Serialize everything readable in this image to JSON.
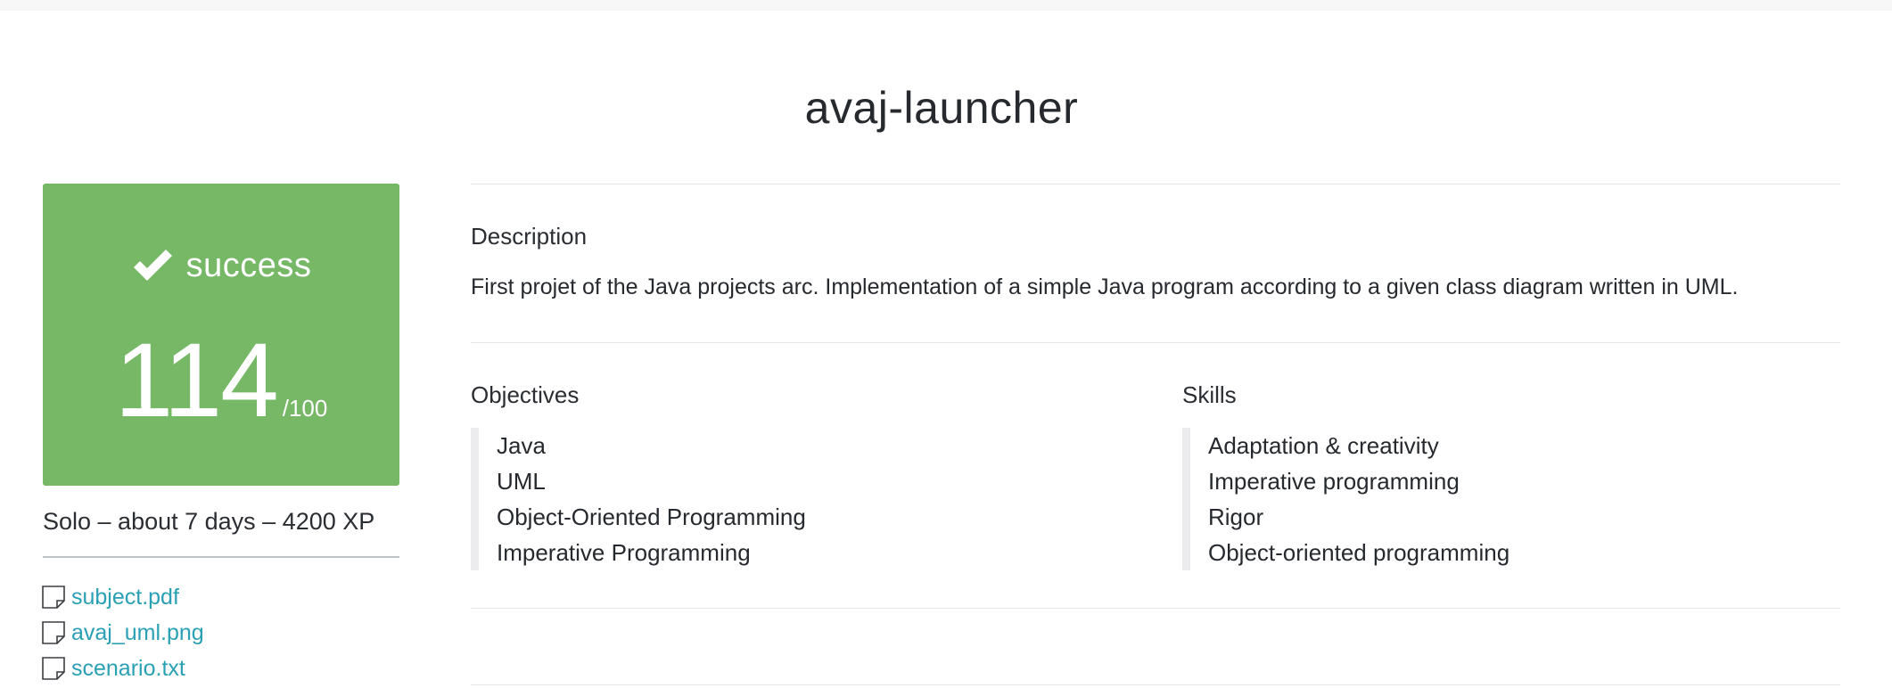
{
  "project": {
    "title": "avaj-launcher"
  },
  "result": {
    "status": "success",
    "score": "114",
    "max_score": "/100"
  },
  "meta": "Solo – about 7 days – 4200 XP",
  "attachments": [
    {
      "label": "subject.pdf"
    },
    {
      "label": "avaj_uml.png"
    },
    {
      "label": "scenario.txt"
    }
  ],
  "description": {
    "heading": "Description",
    "text": "First projet of the Java projects arc. Implementation of a simple Java program according to a given class diagram written in UML."
  },
  "objectives": {
    "heading": "Objectives",
    "items": [
      "Java",
      "UML",
      "Object-Oriented Programming",
      "Imperative Programming"
    ]
  },
  "skills": {
    "heading": "Skills",
    "items": [
      "Adaptation & creativity",
      "Imperative programming",
      "Rigor",
      "Object-oriented programming"
    ]
  },
  "colors": {
    "success_green": "#76b866",
    "link_teal": "#2aa0b5"
  },
  "icons": {
    "status": "check-icon",
    "attachment": "file-icon"
  }
}
